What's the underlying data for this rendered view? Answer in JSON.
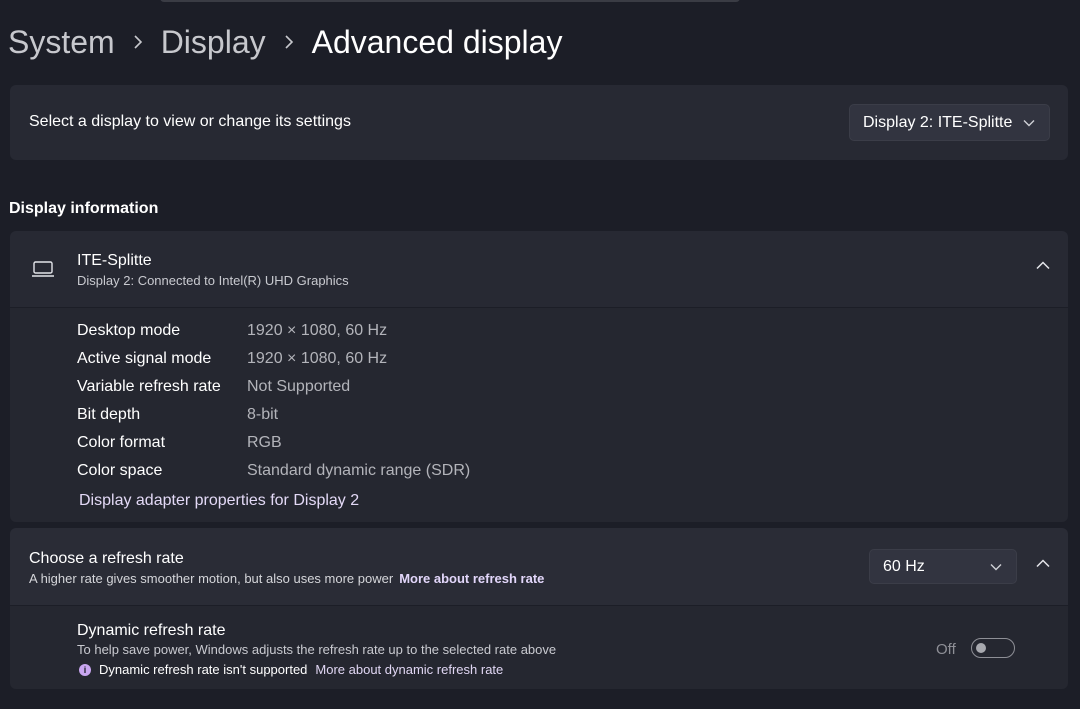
{
  "breadcrumb": [
    "System",
    "Display",
    "Advanced display"
  ],
  "select_display": {
    "label": "Select a display to view or change its settings",
    "value": "Display 2: ITE-Splitte"
  },
  "display_information": {
    "section_title": "Display information",
    "name": "ITE-Splitte",
    "subtitle": "Display 2: Connected to Intel(R) UHD Graphics",
    "rows": [
      {
        "key": "Desktop mode",
        "value": "1920 × 1080, 60 Hz"
      },
      {
        "key": "Active signal mode",
        "value": "1920 × 1080, 60 Hz"
      },
      {
        "key": "Variable refresh rate",
        "value": "Not Supported"
      },
      {
        "key": "Bit depth",
        "value": "8-bit"
      },
      {
        "key": "Color format",
        "value": "RGB"
      },
      {
        "key": "Color space",
        "value": "Standard dynamic range (SDR)"
      }
    ],
    "adapter_link": "Display adapter properties for Display 2"
  },
  "refresh_rate": {
    "title": "Choose a refresh rate",
    "subtitle": "A higher rate gives smoother motion, but also uses more power",
    "more_link": "More about refresh rate",
    "value": "60 Hz"
  },
  "dynamic_refresh": {
    "title": "Dynamic refresh rate",
    "subtitle": "To help save power, Windows adjusts the refresh rate up to the selected rate above",
    "note": "Dynamic refresh rate isn't supported",
    "more_link": "More about dynamic refresh rate",
    "toggle_label": "Off",
    "toggle_on": false
  },
  "colors": {
    "background": "#1c1e27",
    "card": "#272933",
    "accent_link": "#e2d6fa",
    "info_dot": "#c9a6f0"
  }
}
